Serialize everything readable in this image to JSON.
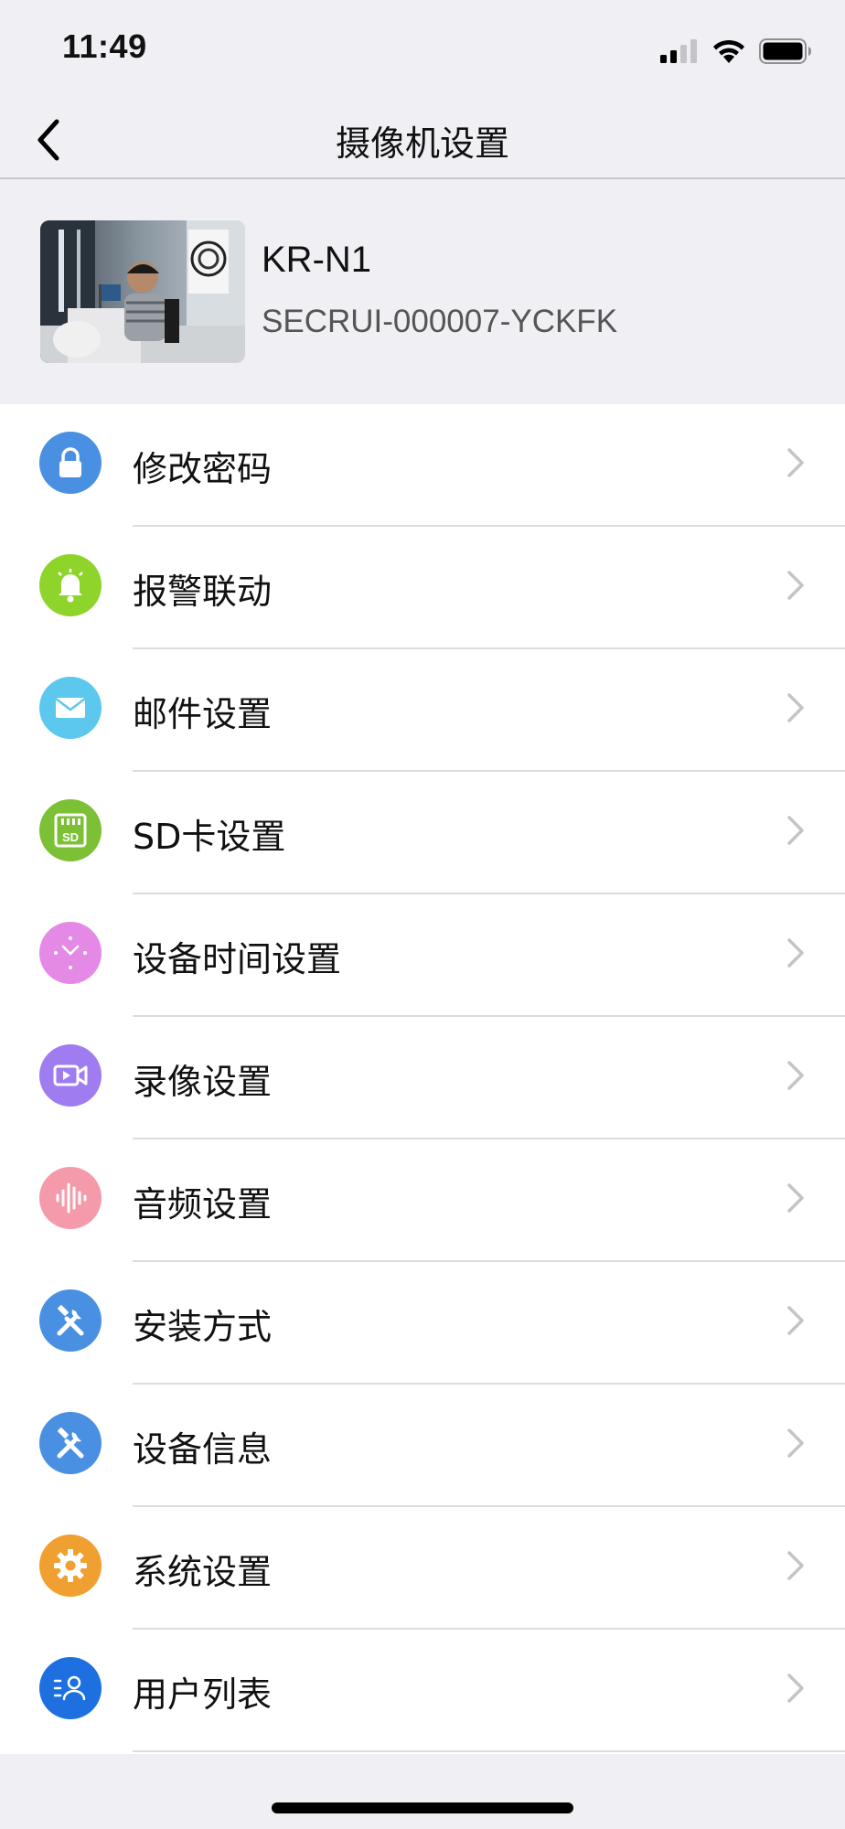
{
  "status_bar": {
    "time": "11:49",
    "signal_icon": "cellular-signal-icon",
    "wifi_icon": "wifi-icon",
    "battery_icon": "battery-icon"
  },
  "nav": {
    "title": "摄像机设置",
    "back_icon": "chevron-left-icon"
  },
  "device": {
    "name": "KR-N1",
    "id": "SECRUI-000007-YCKFK"
  },
  "menu": {
    "items": [
      {
        "label": "修改密码",
        "icon": "lock-icon",
        "color": "#4a90e2"
      },
      {
        "label": "报警联动",
        "icon": "bell-icon",
        "color": "#8fd42b"
      },
      {
        "label": "邮件设置",
        "icon": "mail-icon",
        "color": "#5cc8ee"
      },
      {
        "label": "SD卡设置",
        "icon": "sd-card-icon",
        "color": "#7cc035"
      },
      {
        "label": "设备时间设置",
        "icon": "clock-icon",
        "color": "#e48ae6"
      },
      {
        "label": "录像设置",
        "icon": "video-record-icon",
        "color": "#9f7cf0"
      },
      {
        "label": "音频设置",
        "icon": "audio-wave-icon",
        "color": "#f59aaa"
      },
      {
        "label": "安装方式",
        "icon": "tools-icon",
        "color": "#4a90e2"
      },
      {
        "label": "设备信息",
        "icon": "tools-icon",
        "color": "#4a90e2"
      },
      {
        "label": "系统设置",
        "icon": "gear-icon",
        "color": "#f0a030"
      },
      {
        "label": "用户列表",
        "icon": "user-list-icon",
        "color": "#1e6fe0"
      }
    ]
  }
}
